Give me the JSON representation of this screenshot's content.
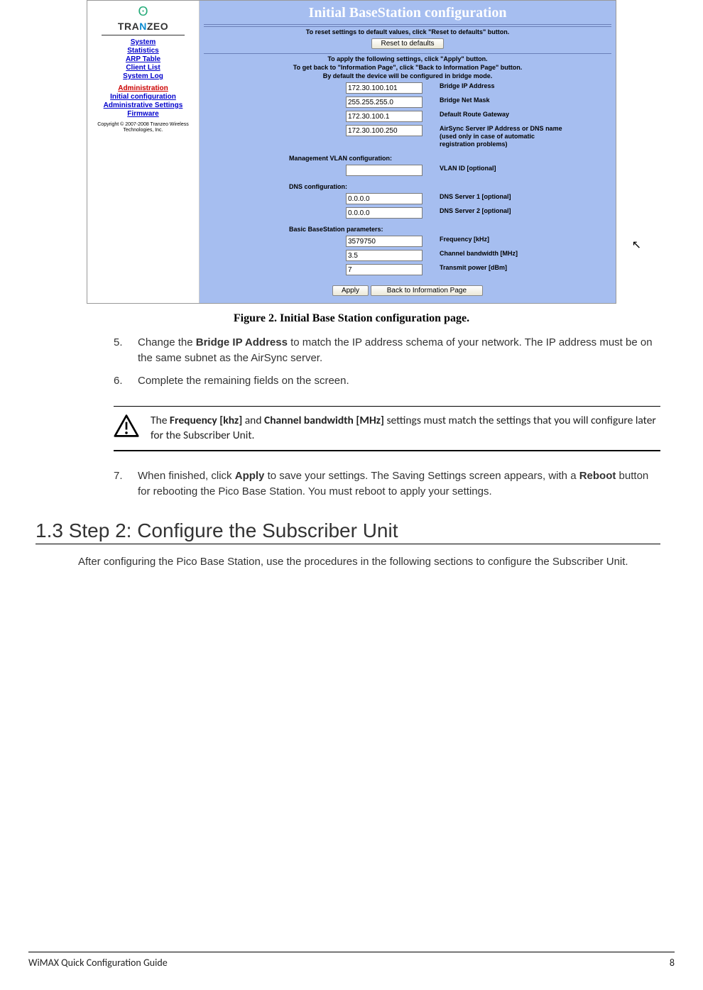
{
  "screenshot": {
    "logo_text_pre": "TRA",
    "logo_text_n": "N",
    "logo_text_post": "ZEO",
    "nav": {
      "system": "System",
      "statistics": "Statistics",
      "arp": "ARP Table",
      "clientlist": "Client List",
      "syslog": "System Log",
      "admin_heading": "Administration",
      "initconfig": "Initial configuration",
      "adminsettings": "Administrative Settings",
      "firmware": "Firmware"
    },
    "copyright": "Copyright © 2007-2008 Tranzeo Wireless Technologies, Inc.",
    "title": "Initial BaseStation configuration",
    "reset_text": "To reset settings to default values, click \"Reset to defaults\" button.",
    "reset_btn": "Reset to defaults",
    "apply_line1": "To apply the following settings, click \"Apply\" button.",
    "apply_line2": "To get back to \"Information Page\", click \"Back to Information Page\" button.",
    "apply_line3": "By default the device will be configured in bridge mode.",
    "fields": {
      "bridge_ip": {
        "value": "172.30.100.101",
        "label": "Bridge IP Address"
      },
      "bridge_mask": {
        "value": "255.255.255.0",
        "label": "Bridge Net Mask"
      },
      "gateway": {
        "value": "172.30.100.1",
        "label": "Default Route Gateway"
      },
      "airsync": {
        "value": "172.30.100.250",
        "label": "AirSync Server IP Address or DNS name (used only in case of automatic registration problems)"
      },
      "vlan_section": "Management VLAN configuration:",
      "vlan_id": {
        "value": "",
        "label": "VLAN ID [optional]"
      },
      "dns_section": "DNS configuration:",
      "dns1": {
        "value": "0.0.0.0",
        "label": "DNS Server 1 [optional]"
      },
      "dns2": {
        "value": "0.0.0.0",
        "label": "DNS Server 2 [optional]"
      },
      "bs_section": "Basic BaseStation parameters:",
      "freq": {
        "value": "3579750",
        "label": "Frequency [kHz]"
      },
      "bw": {
        "value": "3.5",
        "label": "Channel bandwidth [MHz]"
      },
      "txpower": {
        "value": "7",
        "label": "Transmit power [dBm]"
      }
    },
    "apply_btn": "Apply",
    "back_btn": "Back to Information Page"
  },
  "figure_caption": "Figure 2. Initial Base Station configuration page.",
  "steps": {
    "n5": "5.",
    "s5_a": "Change the ",
    "s5_b": "Bridge IP Address",
    "s5_c": " to match the IP address schema of your network. The IP address must be on the same subnet as the AirSync server.",
    "n6": "6.",
    "s6": "Complete the remaining fields on the screen.",
    "n7": "7.",
    "s7_a": "When finished, click ",
    "s7_b": "Apply",
    "s7_c": " to save your settings. The Saving Settings screen appears, with a ",
    "s7_d": "Reboot",
    "s7_e": " button for rebooting the Pico Base Station. You must reboot to apply your settings."
  },
  "callout": {
    "a": "The ",
    "b": "Frequency [khz]",
    "c": " and ",
    "d": "Channel bandwidth [MHz]",
    "e": " settings must match the settings that you will configure later for the Subscriber Unit."
  },
  "heading_1_3": "1.3 Step 2: Configure the Subscriber Unit",
  "body_1_3": "After configuring the Pico Base Station, use the procedures in the following sections to configure the Subscriber Unit.",
  "footer_left": "WiMAX Quick Configuration Guide",
  "footer_right": "8"
}
